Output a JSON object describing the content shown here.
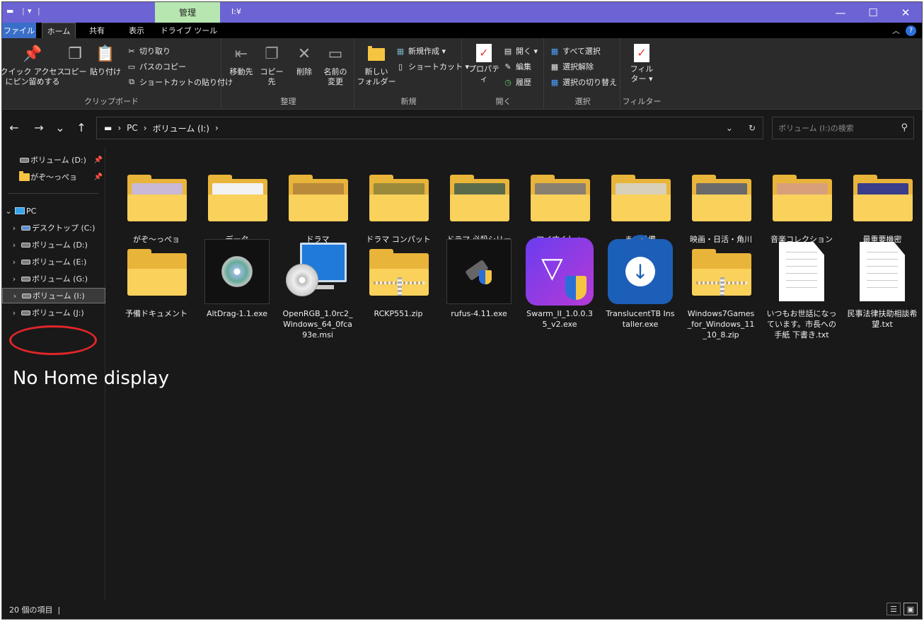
{
  "window": {
    "title": "I:¥",
    "context_tab": "管理",
    "min": "—",
    "max": "☐",
    "close": "✕"
  },
  "qat": {
    "drive": "▬",
    "sep": "|",
    "down": "▾",
    "sep2": "|"
  },
  "tabs": [
    "ファイル",
    "ホーム",
    "共有",
    "表示",
    "ドライブ ツール"
  ],
  "ribbon_ctrl": {
    "collapse": "︿",
    "help": "?"
  },
  "ribbon": {
    "clipboard": {
      "label": "クリップボード",
      "pin": "クイック アクセス\nにピン留めする",
      "copy": "コピー",
      "paste": "貼り付け",
      "cut": "切り取り",
      "copy_path": "パスのコピー",
      "paste_shortcut": "ショートカットの貼り付け"
    },
    "organize": {
      "label": "整理",
      "move": "移動先",
      "copyto": "コピー先",
      "delete": "削除",
      "rename": "名前の\n変更"
    },
    "new": {
      "label": "新規",
      "new_folder": "新しい\nフォルダー",
      "new_item": "新規作成 ▾",
      "shortcut": "ショートカット ▾"
    },
    "open": {
      "label": "開く",
      "properties": "プロパティ",
      "open": "開く ▾",
      "edit": "編集",
      "history": "履歴"
    },
    "select": {
      "label": "選択",
      "all": "すべて選択",
      "none": "選択解除",
      "invert": "選択の切り替え"
    },
    "filter": {
      "label": "フィルター",
      "btn": "フィル\nター ▾"
    }
  },
  "nav": {
    "back": "←",
    "forward": "→",
    "recent": "⌄",
    "up": "↑"
  },
  "address": {
    "drive_icon": "▬",
    "crumbs": [
      "›",
      "PC",
      "›",
      "ボリューム (I:)",
      "›"
    ],
    "dropdown": "⌄",
    "refresh": "↻"
  },
  "search": {
    "placeholder": "ボリューム (I:)の検索",
    "icon": "⚲"
  },
  "sidebar": {
    "pinned": [
      {
        "label": "ボリューム (D:)",
        "pin": "📌"
      },
      {
        "label": "がぞ～っぺョ",
        "pin": "📌"
      }
    ],
    "pc": {
      "chev": "⌄",
      "label": "PC"
    },
    "drives": [
      {
        "chev": "›",
        "label": "デスクトップ (C:)"
      },
      {
        "chev": "›",
        "label": "ボリューム (D:)"
      },
      {
        "chev": "›",
        "label": "ボリューム (E:)"
      },
      {
        "chev": "›",
        "label": "ボリューム (G:)"
      },
      {
        "chev": "›",
        "label": "ボリューム (I:)"
      },
      {
        "chev": "›",
        "label": "ボリューム (J:)"
      }
    ]
  },
  "annotation": "No Home display",
  "files": [
    {
      "name": "がぞ～っぺョ",
      "kind": "folder",
      "color": "#c9b8d6"
    },
    {
      "name": "データ",
      "kind": "folder",
      "color": "#f2f2f2"
    },
    {
      "name": "ドラマ",
      "kind": "folder",
      "color": "#b88a3a"
    },
    {
      "name": "ドラマ コンパット",
      "kind": "folder",
      "color": "#9a8a3a"
    },
    {
      "name": "ドラマ 必殺シリーズ",
      "kind": "folder",
      "color": "#5b6b4a"
    },
    {
      "name": "マイすくしょ",
      "kind": "folder",
      "color": "#8a8070"
    },
    {
      "name": "まい予備",
      "kind": "folder",
      "color": "#d8d0b8"
    },
    {
      "name": "映画・日活・角川",
      "kind": "folder",
      "color": "#6a6a6a"
    },
    {
      "name": "音楽コレクション",
      "kind": "folder",
      "color": "#d8a07a"
    },
    {
      "name": "最重要機密",
      "kind": "folder",
      "color": "#3a3e8a"
    },
    {
      "name": "予備ドキュメント",
      "kind": "folder",
      "color": ""
    },
    {
      "name": "AltDrag-1.1.exe",
      "kind": "exe-disc",
      "color": ""
    },
    {
      "name": "OpenRGB_1.0rc2_Windows_64_0fca93e.msi",
      "kind": "msi",
      "color": ""
    },
    {
      "name": "RCKP551.zip",
      "kind": "zip",
      "color": ""
    },
    {
      "name": "rufus-4.11.exe",
      "kind": "exe-usb",
      "color": ""
    },
    {
      "name": "Swarm_II_1.0.0.35_v2.exe",
      "kind": "exe-swarm",
      "color": ""
    },
    {
      "name": "TranslucentTB Installer.exe",
      "kind": "exe-ttb",
      "color": ""
    },
    {
      "name": "Windows7Games_for_Windows_11_10_8.zip",
      "kind": "zip",
      "color": ""
    },
    {
      "name": "いつもお世話になっています。市長への手紙 下書き.txt",
      "kind": "txt",
      "color": ""
    },
    {
      "name": "民事法律扶助相談希望.txt",
      "kind": "txt",
      "color": ""
    }
  ],
  "status": {
    "count": "20 個の項目",
    "sep": "|",
    "details_view": "☰",
    "icons_view": "▣"
  }
}
